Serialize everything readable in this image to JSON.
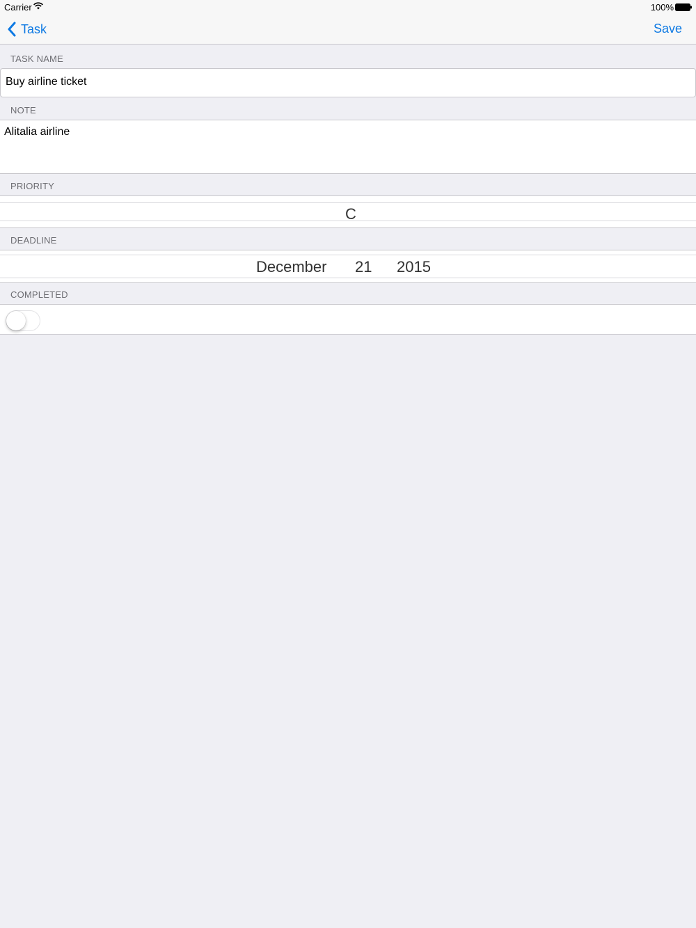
{
  "status_bar": {
    "carrier": "Carrier",
    "battery": "100%"
  },
  "nav": {
    "back_label": "Task",
    "save_label": "Save",
    "accent_color": "#0d79e3"
  },
  "sections": {
    "task_name": {
      "header": "TASK NAME",
      "value": "Buy airline ticket"
    },
    "note": {
      "header": "NOTE",
      "value": "Alitalia airline"
    },
    "priority": {
      "header": "PRIORITY",
      "value": "C"
    },
    "deadline": {
      "header": "DEADLINE",
      "month": "December",
      "day": "21",
      "year": "2015"
    },
    "completed": {
      "header": "COMPLETED",
      "on": false
    }
  }
}
